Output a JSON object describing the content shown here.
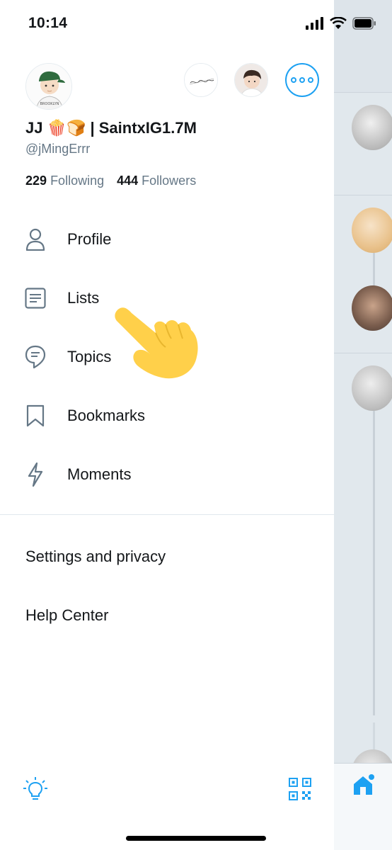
{
  "status_bar": {
    "time": "10:14"
  },
  "profile": {
    "display_name": "JJ 🍿🍞 | SaintxIG1.7M",
    "handle": "@jMingErrr",
    "following_count": "229",
    "following_label": "Following",
    "followers_count": "444",
    "followers_label": "Followers"
  },
  "menu": {
    "items": [
      {
        "label": "Profile",
        "icon": "person-icon"
      },
      {
        "label": "Lists",
        "icon": "list-icon"
      },
      {
        "label": "Topics",
        "icon": "topic-bubble-icon"
      },
      {
        "label": "Bookmarks",
        "icon": "bookmark-icon"
      },
      {
        "label": "Moments",
        "icon": "lightning-icon"
      }
    ]
  },
  "secondary": {
    "settings": "Settings and privacy",
    "help": "Help Center"
  },
  "bottom_bar": {
    "left_icon": "lightbulb-icon",
    "right_icon": "qr-code-icon"
  },
  "colors": {
    "accent": "#1da1f2",
    "text": "#14171a",
    "secondary_text": "#657786",
    "icon": "#657786"
  }
}
